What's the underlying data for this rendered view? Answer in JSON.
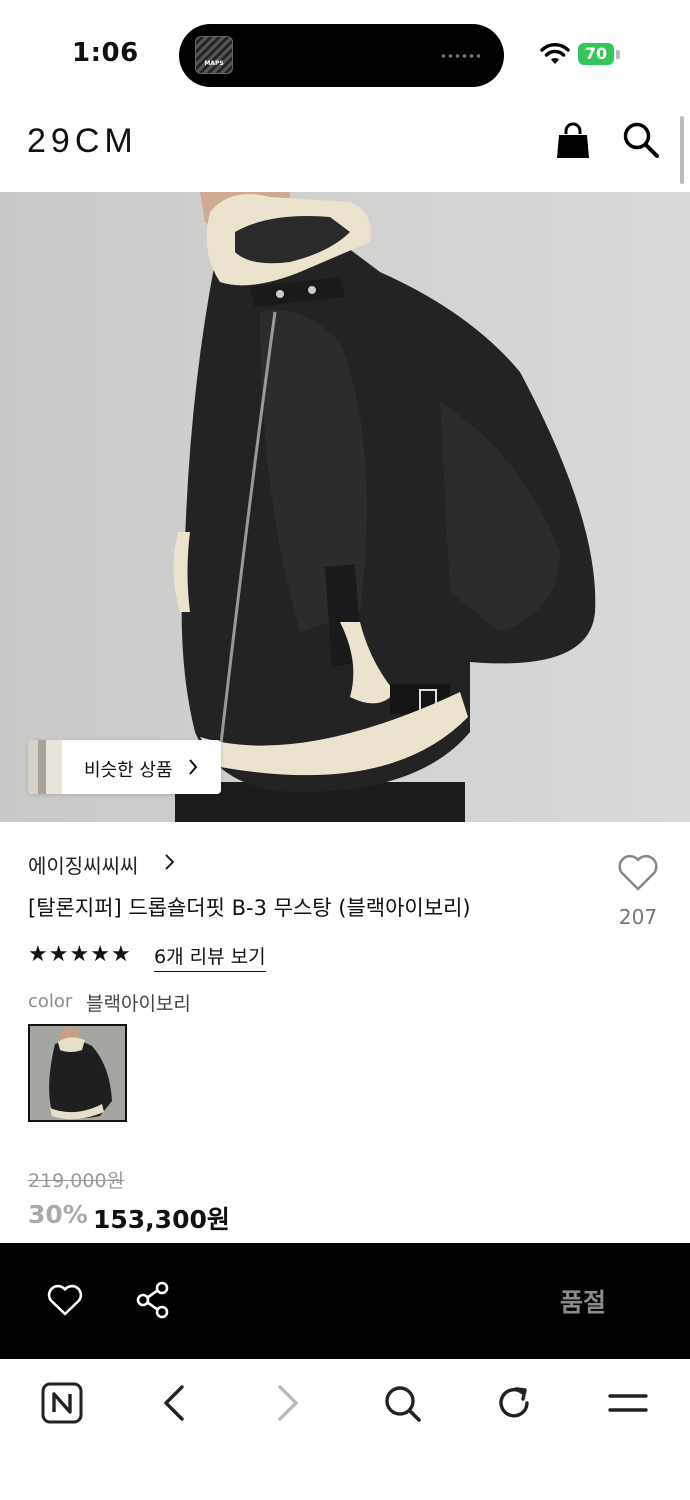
{
  "status_bar": {
    "time": "1:06",
    "battery": "70",
    "album_art_text": "MAPS"
  },
  "header": {
    "logo": "29CM",
    "icons": [
      "shopping-bag-icon",
      "search-icon"
    ]
  },
  "hero": {
    "similar_products_label": "비슷한 상품"
  },
  "product": {
    "brand": "에이징씨씨씨",
    "title": "[탈론지퍼] 드롭숄더핏 B-3 무스탕 (블랙아이보리)",
    "like_count": "207",
    "rating_stars": 5,
    "review_link": "6개 리뷰 보기",
    "color_label": "color",
    "color_value": "블랙아이보리",
    "original_price": "219,000원",
    "discount": "30%",
    "sale_price": "153,300원"
  },
  "action_bar": {
    "sold_out_label": "품절"
  },
  "browser_bar": {
    "icons": [
      "naver-home-icon",
      "back-icon",
      "forward-icon",
      "search-icon",
      "reload-icon",
      "menu-icon"
    ]
  },
  "colors": {
    "accent": "#000000",
    "battery": "#34c759",
    "muted": "#8a8a8a"
  }
}
